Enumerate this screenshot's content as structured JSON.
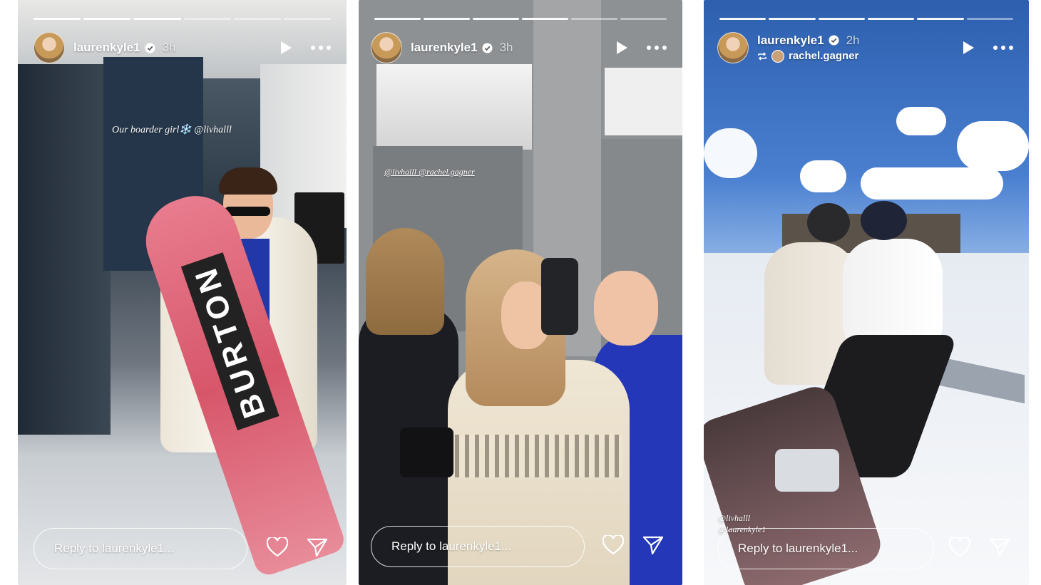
{
  "stories": [
    {
      "username": "laurenkyle1",
      "time": "3h",
      "reply_placeholder": "Reply to laurenkyle1...",
      "overlay": "Our boarder girl❄️ @livhalll",
      "board_text": "BURTON"
    },
    {
      "username": "laurenkyle1",
      "time": "3h",
      "reply_placeholder": "Reply to laurenkyle1...",
      "overlay": "@livhalll @rachel.gagner"
    },
    {
      "username": "laurenkyle1",
      "time": "2h",
      "repost_user": "rachel.gagner",
      "reply_placeholder": "Reply to laurenkyle1...",
      "tags": [
        "@livhalll",
        "@laurenkyle1"
      ]
    }
  ],
  "icons": [
    "play-icon",
    "more-icon",
    "verified-icon",
    "repost-icon",
    "heart-icon",
    "send-icon"
  ],
  "colors": {
    "text": "#ffffff",
    "verified": "#ffffff"
  }
}
